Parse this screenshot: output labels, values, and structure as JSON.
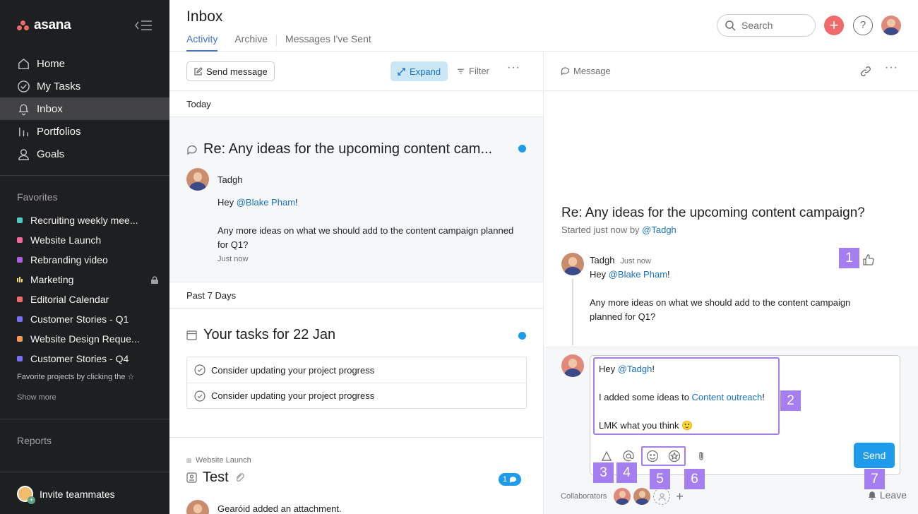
{
  "sidebar": {
    "logo_text": "asana",
    "nav": [
      {
        "label": "Home",
        "icon": "home-icon"
      },
      {
        "label": "My Tasks",
        "icon": "check-circle-icon"
      },
      {
        "label": "Inbox",
        "icon": "bell-icon",
        "active": true
      },
      {
        "label": "Portfolios",
        "icon": "bar-chart-icon"
      },
      {
        "label": "Goals",
        "icon": "person-icon"
      }
    ],
    "favorites_title": "Favorites",
    "favorites": [
      {
        "label": "Recruiting weekly mee...",
        "color": "#4ecbc4"
      },
      {
        "label": "Website Launch",
        "color": "#f06a99"
      },
      {
        "label": "Rebranding video",
        "color": "#aa62e3"
      },
      {
        "label": "Marketing",
        "color": "#f8df72",
        "locked": true
      },
      {
        "label": "Editorial Calendar",
        "color": "#f06a6a"
      },
      {
        "label": "Customer Stories - Q1",
        "color": "#7a6ff0"
      },
      {
        "label": "Website Design Reque...",
        "color": "#fd9a57"
      },
      {
        "label": "Customer Stories - Q4",
        "color": "#7a6ff0"
      }
    ],
    "favorites_hint": "Favorite projects by clicking the ☆",
    "show_more": "Show more",
    "reports": "Reports",
    "invite": "Invite teammates"
  },
  "header": {
    "title": "Inbox",
    "tabs": [
      "Activity",
      "Archive",
      "Messages I've Sent"
    ],
    "search_placeholder": "Search",
    "add_label": "+",
    "help_label": "?"
  },
  "list": {
    "send_message": "Send message",
    "expand": "Expand",
    "filter": "Filter",
    "more": "···",
    "today": "Today",
    "thread": {
      "title": "Re: Any ideas for the upcoming content cam...",
      "author": "Tadgh",
      "greeting_prefix": "Hey ",
      "mention": "@Blake Pham",
      "greeting_suffix": "!",
      "body": "Any more ideas on what we should add to the content campaign planned for Q1?",
      "time": "Just now"
    },
    "past_7_days": "Past 7 Days",
    "tasks_title": "Your tasks for 22 Jan",
    "tasks": [
      "Consider updating your project progress",
      "Consider updating your project progress"
    ],
    "project_tag": "Website Launch",
    "test_title": "Test",
    "comment_count": "1",
    "activity_author": "Gearóid",
    "activity_text": " added an attachment."
  },
  "detail": {
    "type_label": "Message",
    "more": "···",
    "title": "Re: Any ideas for the upcoming content campaign?",
    "started_prefix": "Started just now by ",
    "started_by": "@Tadgh",
    "comment_author": "Tadgh",
    "comment_time": "Just now",
    "comment_greeting_prefix": "Hey ",
    "comment_mention": "@Blake Pham",
    "comment_greeting_suffix": "!",
    "comment_body": "Any more ideas on what we should add to the content campaign planned for Q1?",
    "draft": {
      "line1_prefix": "Hey ",
      "line1_mention": "@Tadgh",
      "line1_suffix": "!",
      "line2_prefix": "I added some ideas to ",
      "line2_link": "Content outreach",
      "line2_suffix": "!",
      "line3": "LMK what you think ",
      "emoji": "🙂"
    },
    "send": "Send",
    "collaborators_label": "Collaborators",
    "leave": "Leave"
  },
  "callouts": [
    "1",
    "2",
    "3",
    "4",
    "5",
    "6",
    "7"
  ]
}
